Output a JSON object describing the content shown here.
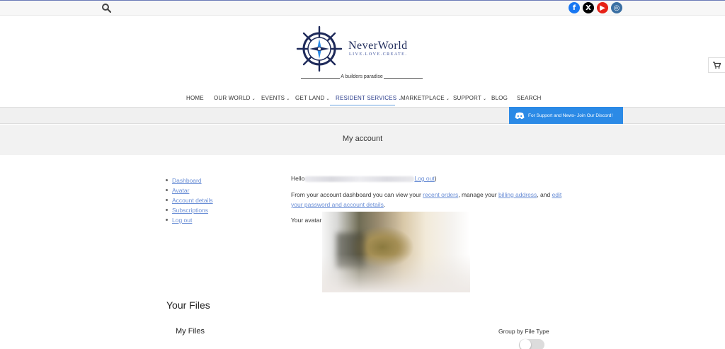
{
  "topbar": {
    "social": [
      {
        "name": "facebook",
        "glyph": "f"
      },
      {
        "name": "x",
        "glyph": "X"
      },
      {
        "name": "youtube",
        "glyph": "▶"
      },
      {
        "name": "instagram",
        "glyph": "◎"
      }
    ]
  },
  "brand": {
    "name": "NeverWorld",
    "tagline": "LIVE.LOVE.CREATE.",
    "subtitle": "A builders paradise"
  },
  "nav": {
    "items": [
      {
        "label": "HOME",
        "has_dropdown": false
      },
      {
        "label": "OUR WORLD",
        "has_dropdown": true
      },
      {
        "label": "EVENTS",
        "has_dropdown": true
      },
      {
        "label": "GET LAND",
        "has_dropdown": true
      },
      {
        "label": "RESIDENT SERVICES",
        "has_dropdown": true,
        "active": true
      },
      {
        "label": "MARKETPLACE",
        "has_dropdown": true
      },
      {
        "label": "SUPPORT",
        "has_dropdown": true
      },
      {
        "label": "BLOG",
        "has_dropdown": false
      },
      {
        "label": "SEARCH",
        "has_dropdown": false
      }
    ]
  },
  "discord": {
    "label": "For Support and News- Join Our Discord!"
  },
  "page": {
    "title": "My account"
  },
  "account_nav": {
    "items": [
      "Dashboard",
      "Avatar",
      "Account details",
      "Subscriptions",
      "Log out"
    ]
  },
  "content": {
    "hello_prefix": "Hello",
    "logout_link": "Log out",
    "closing_paren": ")",
    "dashboard_text_1": "From your account dashboard you can view your ",
    "recent_orders": "recent orders",
    "dashboard_text_2": ", manage your ",
    "billing_address": "billing address",
    "dashboard_text_3": ", and ",
    "edit_link": "edit your password and account details",
    "dashboard_text_4": ".",
    "avatar_label": "Your avatar"
  },
  "files": {
    "heading": "Your Files",
    "subheading": "My Files",
    "group_label": "Group by File Type",
    "group_toggle_on": false
  },
  "colors": {
    "accent": "#2b8ae6",
    "link": "#6b8fd6",
    "brand": "#1e2a5a"
  }
}
